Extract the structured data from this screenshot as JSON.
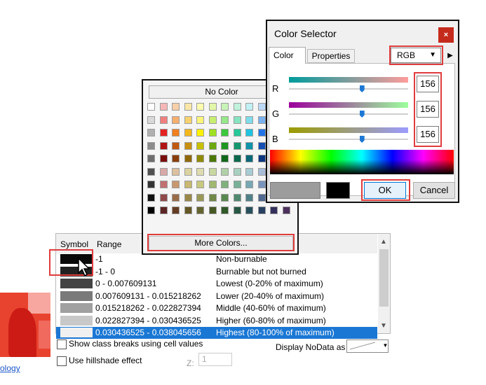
{
  "background": {
    "link_text": "ology",
    "table": {
      "headers": {
        "symbol": "Symbol",
        "range": "Range"
      },
      "rows": [
        {
          "range": "-1",
          "label": "Non-burnable",
          "color": "#0a0a0a",
          "selected": false
        },
        {
          "range": "-1 - 0",
          "label": "Burnable but not burned",
          "color": "#222222",
          "selected": false
        },
        {
          "range": "0 - 0.007609131",
          "label": "Lowest (0-20% of maximum)",
          "color": "#444444",
          "selected": false
        },
        {
          "range": "0.007609131 - 0.015218262",
          "label": "Lower (20-40% of maximum)",
          "color": "#7a7a7a",
          "selected": false
        },
        {
          "range": "0.015218262 - 0.022827394",
          "label": "Middle (40-60% of maximum)",
          "color": "#a0a0a0",
          "selected": false
        },
        {
          "range": "0.022827394 - 0.030436525",
          "label": "Higher (60-80% of maximum)",
          "color": "#c8c8c8",
          "selected": false
        },
        {
          "range": "0.030436525 - 0.038045656",
          "label": "Highest (80-100% of maximum)",
          "color": "#f0f0f0",
          "selected": true
        }
      ]
    },
    "show_class_breaks_label": "Show class breaks using cell values",
    "hillshade_label": "Use hillshade effect",
    "z_label": "Z:",
    "z_value": "1",
    "nodata_label": "Display NoData as"
  },
  "palette": {
    "no_color_label": "No Color",
    "more_colors_label": "More Colors...",
    "colors": [
      [
        "#ffffff",
        "#f5b7b7",
        "#f7cfa8",
        "#fae7a8",
        "#fdfbb0",
        "#e3f7a8",
        "#c8f4b8",
        "#c0f2dc",
        "#c0f0f4",
        "#bcd8f6",
        "#c6c2f2",
        "#e2c0f0"
      ],
      [
        "#d9d9d9",
        "#f08080",
        "#f5b070",
        "#f8d26e",
        "#fbf57a",
        "#c8ee70",
        "#96e88a",
        "#86e4c0",
        "#80dcea",
        "#7ab0ee",
        "#8e88e8",
        "#c48ae4"
      ],
      [
        "#b0b0b0",
        "#e52222",
        "#f08020",
        "#f5b81c",
        "#fff200",
        "#a0e020",
        "#3cc83c",
        "#28c898",
        "#20c4e0",
        "#2274e6",
        "#4a3ce0",
        "#a63cd8"
      ],
      [
        "#8c8c8c",
        "#b01414",
        "#c05a10",
        "#c89010",
        "#c8c000",
        "#6ea810",
        "#1e9622",
        "#14966e",
        "#1094aa",
        "#1450b4",
        "#2c20a8",
        "#7a20a4"
      ],
      [
        "#6e6e6e",
        "#7a0c0c",
        "#8a3e08",
        "#906808",
        "#908a00",
        "#4c7808",
        "#10681a",
        "#0c684c",
        "#0a6878",
        "#0c3680",
        "#1a1478",
        "#561476"
      ],
      [
        "#505050",
        "#d8a8a8",
        "#dcc0a0",
        "#dcd4a0",
        "#dcdcb0",
        "#c8d8a0",
        "#b0d0a8",
        "#a8d0c0",
        "#a8ccd4",
        "#a8bcd8",
        "#b0acd4",
        "#c8acd4"
      ],
      [
        "#333333",
        "#c07070",
        "#c89870",
        "#c8b870",
        "#c8c880",
        "#a0b870",
        "#80b07c",
        "#78b098",
        "#78a8b4",
        "#7894bc",
        "#8480b4",
        "#a480b4"
      ],
      [
        "#111111",
        "#904848",
        "#986c48",
        "#988848",
        "#989858",
        "#708848",
        "#588850",
        "#508870",
        "#508088",
        "#506890",
        "#5c5888",
        "#7c5888"
      ],
      [
        "#000000",
        "#5c2424",
        "#643c24",
        "#645824",
        "#646430",
        "#465824",
        "#305828",
        "#285844",
        "#28505c",
        "#284060",
        "#34305c",
        "#4c305c"
      ]
    ]
  },
  "selector": {
    "title": "Color Selector",
    "close_glyph": "×",
    "tabs": [
      "Color",
      "Properties"
    ],
    "mode": "RGB",
    "channels": [
      {
        "label": "R",
        "value": "156",
        "fraction": 0.61,
        "gradient_from": "#009c9c",
        "gradient_to": "#ff9c9c"
      },
      {
        "label": "G",
        "value": "156",
        "fraction": 0.61,
        "gradient_from": "#9c009c",
        "gradient_to": "#9cff9c"
      },
      {
        "label": "B",
        "value": "156",
        "fraction": 0.61,
        "gradient_from": "#9c9c00",
        "gradient_to": "#9c9cff"
      }
    ],
    "preview_color": "#9c9c9c",
    "ok_label": "OK",
    "cancel_label": "Cancel"
  }
}
